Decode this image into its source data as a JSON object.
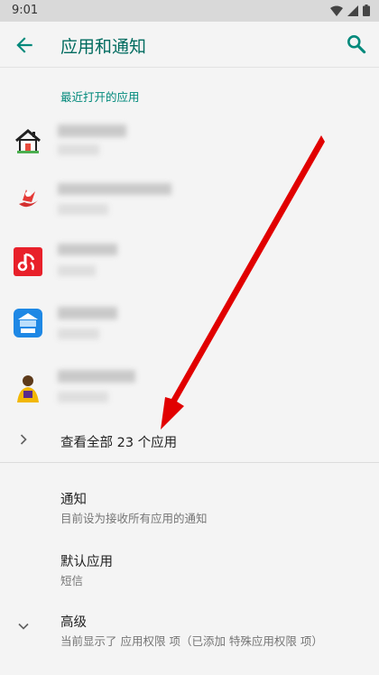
{
  "status_bar": {
    "time": "9:01"
  },
  "app_bar": {
    "title": "应用和通知"
  },
  "recent": {
    "header": "最近打开的应用",
    "apps": [
      {
        "icon": "house-app-icon"
      },
      {
        "icon": "red-logo-app-icon"
      },
      {
        "icon": "music-app-icon"
      },
      {
        "icon": "blue-building-app-icon"
      },
      {
        "icon": "basketball-player-app-icon"
      }
    ]
  },
  "see_all": {
    "label": "查看全部 23 个应用"
  },
  "prefs": [
    {
      "title": "通知",
      "summary": "目前设为接收所有应用的通知"
    },
    {
      "title": "默认应用",
      "summary": "短信"
    },
    {
      "title": "高级",
      "summary": "当前显示了 应用权限 项（已添加 特殊应用权限 项）"
    }
  ],
  "colors": {
    "accent": "#00897b",
    "annotation_arrow": "#e10000"
  }
}
